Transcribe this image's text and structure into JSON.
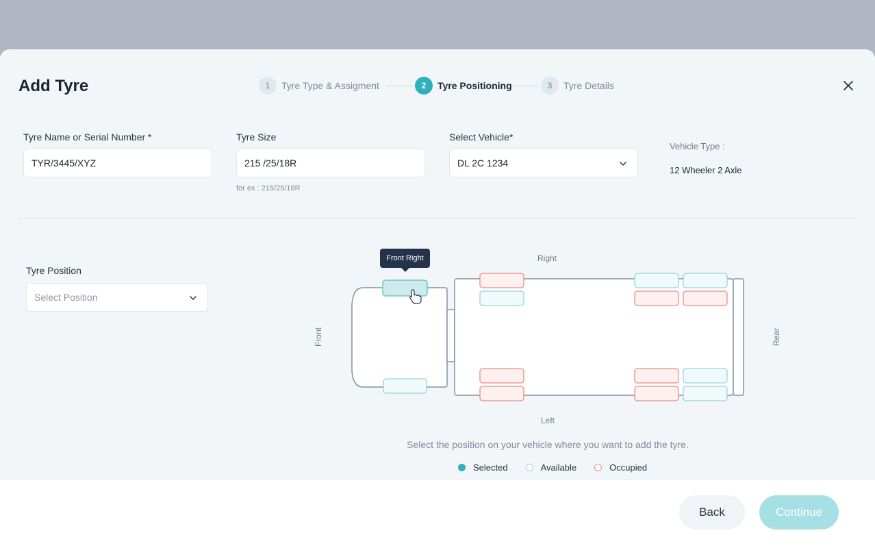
{
  "modal": {
    "title": "Add Tyre"
  },
  "stepper": {
    "steps": [
      {
        "number": "1",
        "label": "Tyre Type & Assigment",
        "state": "completed"
      },
      {
        "number": "2",
        "label": "Tyre Positioning",
        "state": "active"
      },
      {
        "number": "3",
        "label": "Tyre Details",
        "state": "pending"
      }
    ]
  },
  "form": {
    "tyre_name": {
      "label": "Tyre Name or Serial Number *",
      "value": "TYR/3445/XYZ"
    },
    "tyre_size": {
      "label": "Tyre Size",
      "value": "215 /25/18R",
      "hint": "for ex : 215/25/18R"
    },
    "vehicle": {
      "label": "Select Vehicle*",
      "value": "DL 2C 1234"
    },
    "vehicle_type": {
      "label": "Vehicle Type :",
      "value": "12 Wheeler 2 Axle"
    },
    "tyre_position": {
      "label": "Tyre Position",
      "placeholder": "Select Position"
    }
  },
  "diagram": {
    "tooltip": "Front Right",
    "labels": {
      "right": "Right",
      "left": "Left",
      "front": "Front",
      "rear": "Rear"
    },
    "helper": "Select the position on your vehicle where you want to add the tyre.",
    "colors": {
      "selected": "#2fb1bb",
      "available": "#8fd6dc",
      "occupied": "#ec8b83"
    }
  },
  "legend": {
    "selected": "Selected",
    "available": "Available",
    "occupied": "Occupied"
  },
  "footer": {
    "back": "Back",
    "continue": "Continue"
  }
}
